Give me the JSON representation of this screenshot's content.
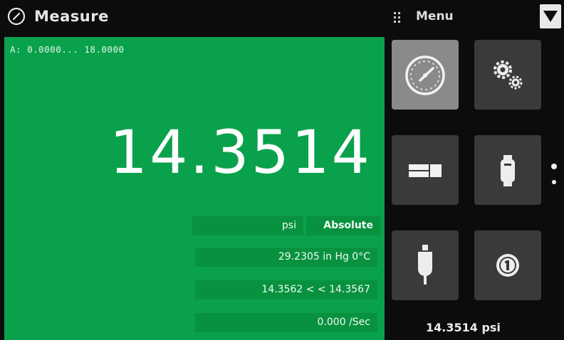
{
  "header": {
    "title": "Measure",
    "menu_label": "Menu",
    "app_icon": "gauge-icon",
    "menu_grip_icon": "grip-icon",
    "menu_button_icon": "triangle-down-icon"
  },
  "measurement": {
    "range": "A: 0.0000... 18.0000",
    "value": "14.3514",
    "unit": "psi",
    "mode": "Absolute",
    "alt_reading": "29.2305 in Hg 0°C",
    "min_max": "14.3562 < < 14.3567",
    "rate": "0.000 /Sec"
  },
  "tiles": [
    {
      "icon": "gauge-icon",
      "active": true
    },
    {
      "icon": "gears-icon",
      "active": false
    },
    {
      "icon": "display-layout-icon",
      "active": false
    },
    {
      "icon": "sensor-icon",
      "active": false
    },
    {
      "icon": "probe-icon",
      "active": false
    },
    {
      "icon": "info-icon",
      "active": false
    }
  ],
  "footer": {
    "reading": "14.3514 psi"
  },
  "colors": {
    "background": "#0c0c0c",
    "panel": "#0aa14c",
    "panel_row": "#08923f",
    "tile": "#3a3a3a",
    "tile_active": "#8a8a8a"
  }
}
